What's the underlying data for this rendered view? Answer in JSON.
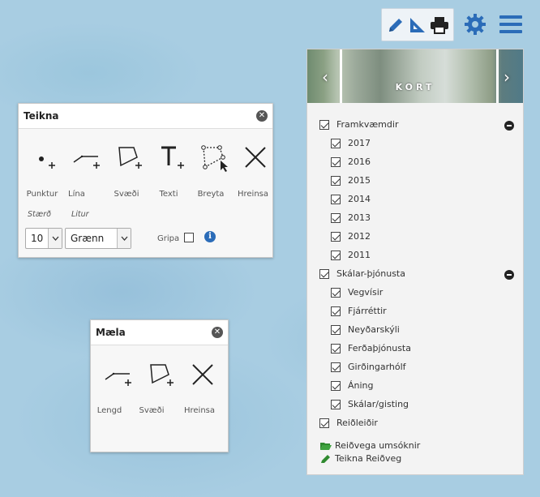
{
  "toolbar": {
    "icons": [
      "pencil-icon",
      "ruler-triangle-icon",
      "printer-icon",
      "gear-icon",
      "menu-icon"
    ],
    "accent_color": "#2b6cb8"
  },
  "draw_panel": {
    "title": "Teikna",
    "tools": [
      {
        "label": "Punktur",
        "icon": "point-plus-icon"
      },
      {
        "label": "Lína",
        "icon": "line-plus-icon"
      },
      {
        "label": "Svæði",
        "icon": "polygon-plus-icon"
      },
      {
        "label": "Texti",
        "icon": "text-plus-icon"
      },
      {
        "label": "Breyta",
        "icon": "edit-shape-icon"
      },
      {
        "label": "Hreinsa",
        "icon": "clear-x-icon"
      }
    ],
    "size_label": "Stærð",
    "color_label": "Litur",
    "size_value": "10",
    "color_value": "Grænn",
    "snap_label": "Gripa"
  },
  "measure_panel": {
    "title": "Mæla",
    "tools": [
      {
        "label": "Lengd",
        "icon": "line-plus-icon"
      },
      {
        "label": "Svæði",
        "icon": "polygon-plus-icon"
      },
      {
        "label": "Hreinsa",
        "icon": "clear-x-icon"
      }
    ]
  },
  "layers": {
    "banner_label": "KORT",
    "groups": [
      {
        "label": "Framkvæmdir",
        "checked": true,
        "items": [
          "2017",
          "2016",
          "2015",
          "2014",
          "2013",
          "2012",
          "2011"
        ]
      },
      {
        "label": "Skálar-þjónusta",
        "checked": true,
        "items": [
          "Vegvísir",
          "Fjárréttir",
          "Neyðarskýli",
          "Ferðaþjónusta",
          "Girðingarhólf",
          "Áning",
          "Skálar/gisting"
        ]
      },
      {
        "label": "Reiðleiðir",
        "checked": true,
        "items": []
      }
    ],
    "links": [
      {
        "label": "Reiðvega umsóknir",
        "icon": "folder-open-icon",
        "color": "#2f8a2f"
      },
      {
        "label": "Teikna Reiðveg",
        "icon": "pencil-icon",
        "color": "#2f8a2f"
      }
    ]
  }
}
